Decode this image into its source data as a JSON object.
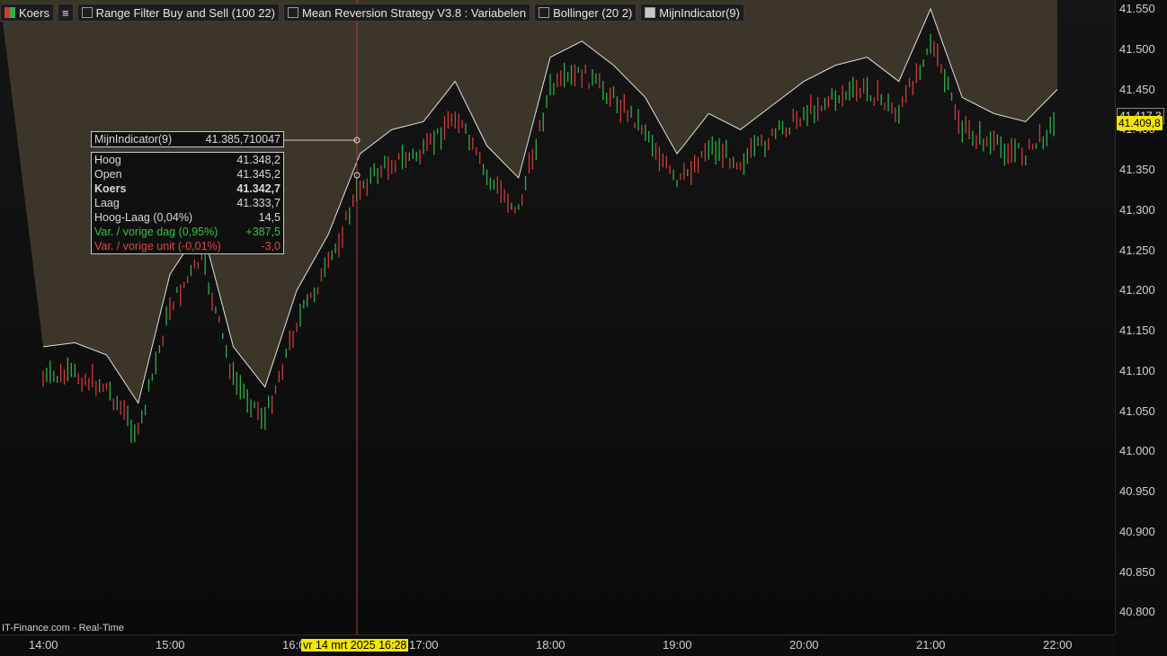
{
  "toolbar": {
    "koers_label": "Koers",
    "list_icon": "list-icon",
    "indicators": [
      {
        "label": "Range Filter Buy and Sell (100 22)",
        "checked": false
      },
      {
        "label": "Mean Reversion Strategy V3.8 : Variabelen",
        "checked": false
      },
      {
        "label": "Bollinger (20 2)",
        "checked": false
      },
      {
        "label": "MijnIndicator(9)",
        "checked": true
      }
    ]
  },
  "indicator_tooltip": {
    "name": "MijnIndicator(9)",
    "value": "41.385,710047"
  },
  "ohlc_tooltip": {
    "rows": [
      {
        "label": "Hoog",
        "value": "41.348,2",
        "style": "normal"
      },
      {
        "label": "Open",
        "value": "41.345,2",
        "style": "normal"
      },
      {
        "label": "Koers",
        "value": "41.342,7",
        "style": "bold"
      },
      {
        "label": "Laag",
        "value": "41.333,7",
        "style": "normal"
      },
      {
        "label": "Hoog-Laag (0,04%)",
        "value": "14,5",
        "style": "normal"
      },
      {
        "label": "Var. / vorige dag (0,95%)",
        "value": "+387,5",
        "style": "green"
      },
      {
        "label": "Var. / vorige unit (-0,01%)",
        "value": "-3,0",
        "style": "red"
      }
    ]
  },
  "y_axis": {
    "ticks": [
      "41.550",
      "41.500",
      "41.450",
      "41.400",
      "41.350",
      "41.300",
      "41.250",
      "41.200",
      "41.150",
      "41.100",
      "41.050",
      "41.000",
      "40.950",
      "40.900",
      "40.850",
      "40.800"
    ],
    "tick_values": [
      41550,
      41500,
      41450,
      41400,
      41350,
      41300,
      41250,
      41200,
      41150,
      41100,
      41050,
      41000,
      40950,
      40900,
      40850,
      40800
    ],
    "indicator_tag": "41.417,3",
    "price_tag": "41.409,8"
  },
  "x_axis": {
    "ticks": [
      "14:00",
      "15:00",
      "16:00",
      "17:00",
      "18:00",
      "19:00",
      "20:00",
      "21:00",
      "22:00"
    ],
    "cursor_label": "vr 14 mrt 2025 16:28"
  },
  "footer": "IT-Finance.com - Real-Time",
  "colors": {
    "up": "#2fb04a",
    "down": "#d23a3a",
    "band_fill": "#3b3629",
    "band_line": "#e0e0e0",
    "cursor": "#b83a3a",
    "price_tag": "#f3e600"
  },
  "chart_data": {
    "type": "line",
    "xlabel": "",
    "ylabel": "",
    "ylim": [
      40780,
      41560
    ],
    "x": [
      "14:00",
      "14:15",
      "14:30",
      "14:45",
      "15:00",
      "15:15",
      "15:30",
      "15:45",
      "16:00",
      "16:15",
      "16:30",
      "16:45",
      "17:00",
      "17:15",
      "17:30",
      "17:45",
      "18:00",
      "18:15",
      "18:30",
      "18:45",
      "19:00",
      "19:15",
      "19:30",
      "19:45",
      "20:00",
      "20:15",
      "20:30",
      "20:45",
      "21:00",
      "21:15",
      "21:30",
      "21:45",
      "22:00"
    ],
    "series": [
      {
        "values": [
          41090,
          41095,
          41080,
          41020,
          41180,
          41240,
          41090,
          41040,
          41160,
          41230,
          41330,
          41360,
          41370,
          41420,
          41340,
          41300,
          41450,
          41470,
          41440,
          41400,
          41330,
          41380,
          41360,
          41390,
          41420,
          41440,
          41450,
          41420,
          41510,
          41400,
          41380,
          41370,
          41410
        ]
      }
    ]
  }
}
